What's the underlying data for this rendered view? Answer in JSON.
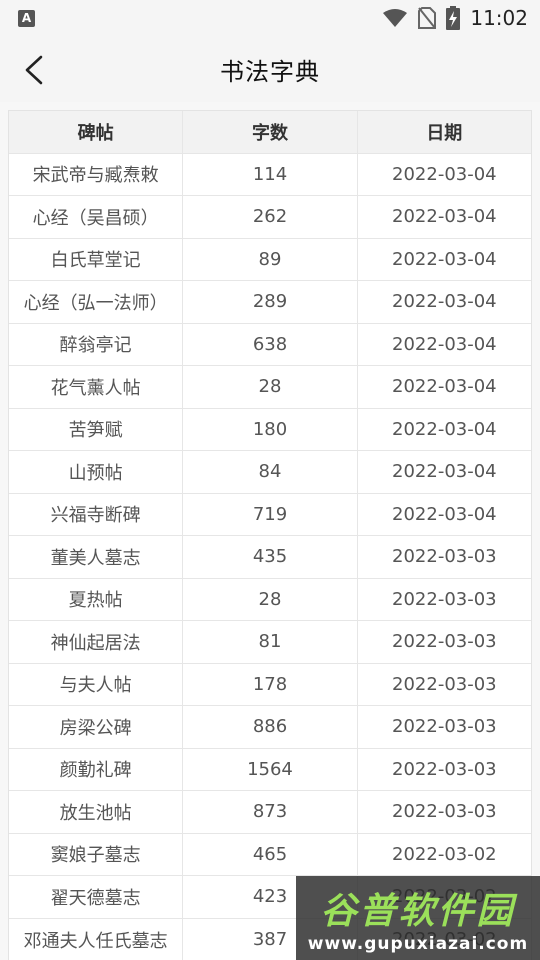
{
  "status": {
    "time": "11:02",
    "badge": "A"
  },
  "appbar": {
    "title": "书法字典"
  },
  "table": {
    "headers": [
      "碑帖",
      "字数",
      "日期"
    ],
    "rows": [
      [
        "宋武帝与臧焘敕",
        "114",
        "2022-03-04"
      ],
      [
        "心经（吴昌硕）",
        "262",
        "2022-03-04"
      ],
      [
        "白氏草堂记",
        "89",
        "2022-03-04"
      ],
      [
        "心经（弘一法师）",
        "289",
        "2022-03-04"
      ],
      [
        "醉翁亭记",
        "638",
        "2022-03-04"
      ],
      [
        "花气薰人帖",
        "28",
        "2022-03-04"
      ],
      [
        "苦笋赋",
        "180",
        "2022-03-04"
      ],
      [
        "山预帖",
        "84",
        "2022-03-04"
      ],
      [
        "兴福寺断碑",
        "719",
        "2022-03-04"
      ],
      [
        "董美人墓志",
        "435",
        "2022-03-03"
      ],
      [
        "夏热帖",
        "28",
        "2022-03-03"
      ],
      [
        "神仙起居法",
        "81",
        "2022-03-03"
      ],
      [
        "与夫人帖",
        "178",
        "2022-03-03"
      ],
      [
        "房梁公碑",
        "886",
        "2022-03-03"
      ],
      [
        "颜勤礼碑",
        "1564",
        "2022-03-03"
      ],
      [
        "放生池帖",
        "873",
        "2022-03-03"
      ],
      [
        "窦娘子墓志",
        "465",
        "2022-03-02"
      ],
      [
        "翟天德墓志",
        "423",
        "2022-03-02"
      ],
      [
        "邓通夫人任氏墓志",
        "387",
        "2022-03-02"
      ]
    ]
  },
  "watermark": {
    "main": "谷普软件园",
    "sub": "www.gupuxiazai.com"
  }
}
